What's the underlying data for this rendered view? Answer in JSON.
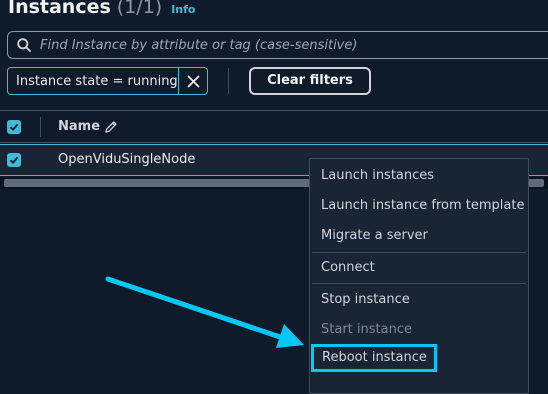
{
  "header": {
    "title": "Instances",
    "count": "(1/1)",
    "info_link": "Info"
  },
  "search": {
    "placeholder": "Find Instance by attribute or tag (case-sensitive)",
    "icon": "search-icon"
  },
  "filter_token": {
    "label": "Instance state = running",
    "remove_icon": "close-icon"
  },
  "toolbar": {
    "clear_filters": "Clear filters"
  },
  "table": {
    "columns": [
      {
        "label": "Name",
        "icon": "pencil-icon"
      }
    ],
    "rows": [
      {
        "name": "OpenViduSingleNode",
        "selected": true
      }
    ]
  },
  "context_menu": {
    "items": [
      {
        "label": "Launch instances",
        "disabled": false
      },
      {
        "label": "Launch instance from template",
        "disabled": false
      },
      {
        "label": "Migrate a server",
        "disabled": false
      },
      {
        "label": "Connect",
        "disabled": false
      },
      {
        "label": "Stop instance",
        "disabled": false
      },
      {
        "label": "Start instance",
        "disabled": true
      },
      {
        "label": "Reboot instance",
        "disabled": false,
        "highlighted": true
      }
    ]
  },
  "colors": {
    "accent": "#44b9d6",
    "annotation": "#00c8f5",
    "background": "#0f1b2a"
  }
}
